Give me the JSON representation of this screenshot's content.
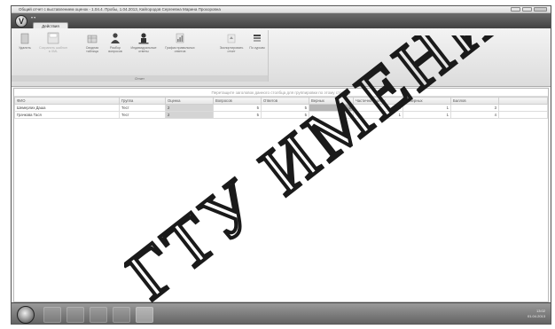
{
  "window": {
    "title": "Общий отчет с выставлением оценок - 1.04.4. Пробы, 1.04.2013, Кайгородов Сергеевна Марина Прохоровна"
  },
  "ribbon": {
    "quick_access": "▾ ▾",
    "active_tab": "Действия",
    "buttons": [
      {
        "label": "Удалить",
        "icon": "delete-icon"
      },
      {
        "label": "Сохранить шаблон в XML",
        "icon": "save-icon"
      },
      {
        "label": "Сводная таблица",
        "icon": "table-icon"
      },
      {
        "label": "Разбор вопросов",
        "icon": "users-icon"
      },
      {
        "label": "Индивидуальные ответы",
        "icon": "user-icon"
      },
      {
        "label": "График правильных ответов",
        "icon": "chart-icon"
      },
      {
        "label": "Экспортировать отчет",
        "icon": "export-icon"
      },
      {
        "label": "По курсам",
        "icon": "filter-icon"
      }
    ],
    "group_label": "Отчет"
  },
  "content": {
    "hint": "Перетащите заголовок данного столбца для группировки по этому столбцу"
  },
  "table": {
    "columns": [
      "ФИО",
      "Группа",
      "Оценка",
      "Вопросов",
      "Ответов",
      "Верных",
      "Частично верных",
      "Неверных",
      "Баллов"
    ],
    "rows": [
      {
        "name": "Шемерлих Даша",
        "group": "Тест",
        "grade": "2",
        "questions": "5",
        "answers": "5",
        "correct": "0",
        "partial": "1",
        "wrong": "1",
        "points": "3"
      },
      {
        "name": "Грачкова Тася",
        "group": "Тест",
        "grade": "2",
        "questions": "5",
        "answers": "5",
        "correct": "0",
        "partial": "1",
        "wrong": "1",
        "points": "4"
      }
    ]
  },
  "taskbar": {
    "apps": [
      "explorer-icon",
      "browser-icon",
      "skype-icon",
      "folder-icon",
      "app-icon"
    ],
    "tray_time": "13:02",
    "tray_date": "01.04.2013"
  },
  "watermark": {
    "text": "ГТУ ИМЕНИ П"
  }
}
